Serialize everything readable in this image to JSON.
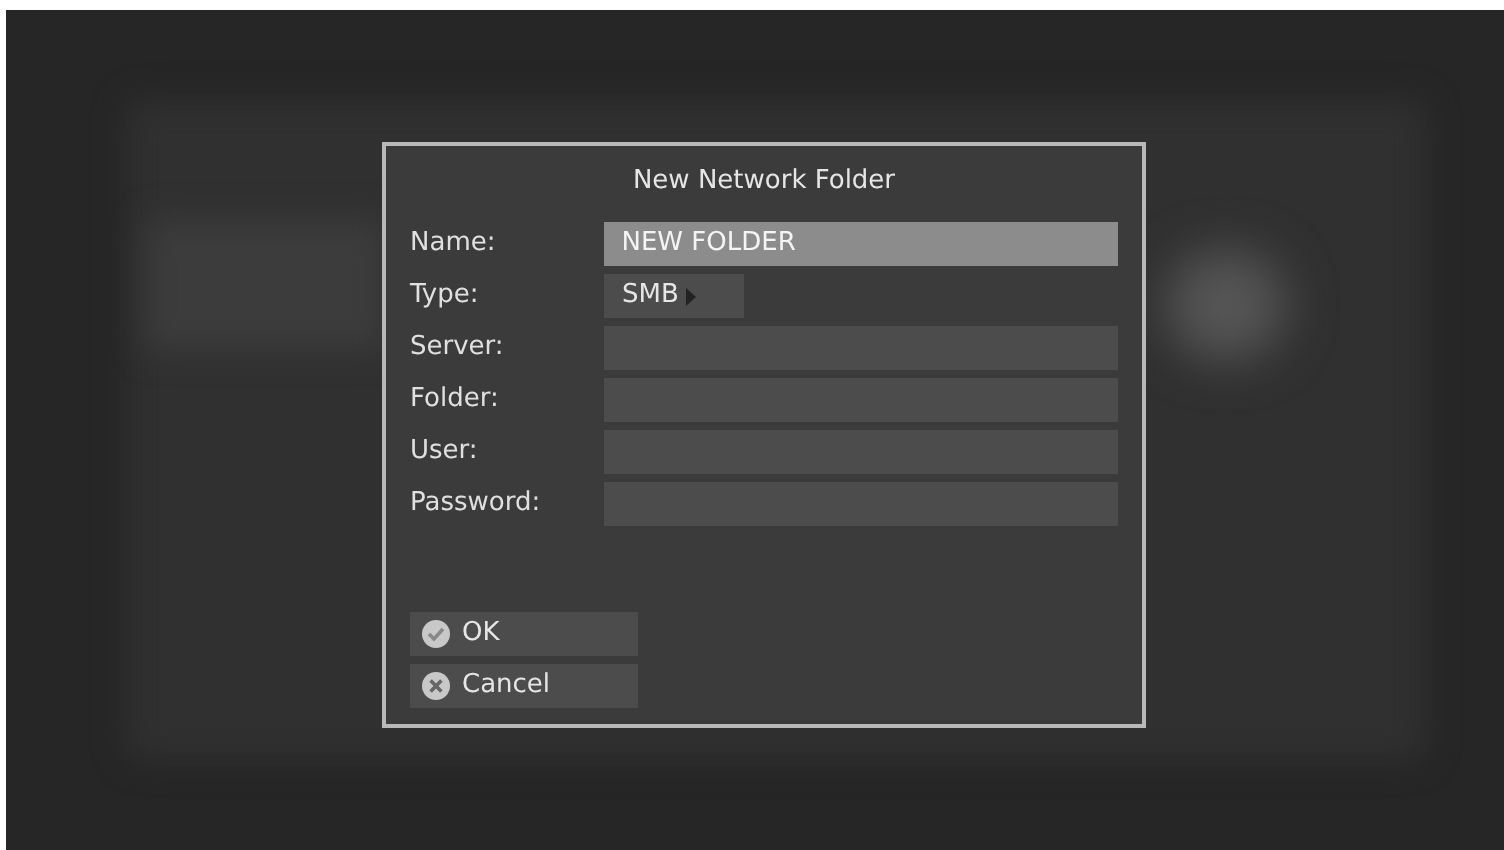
{
  "dialog": {
    "title": "New Network Folder",
    "fields": [
      {
        "label": "Name:",
        "kind": "text",
        "value": "NEW FOLDER",
        "selected": true
      },
      {
        "label": "Type:",
        "kind": "select",
        "value": "SMB",
        "selected": false
      },
      {
        "label": "Server:",
        "kind": "text",
        "selected": false
      },
      {
        "label": "Folder:",
        "kind": "text",
        "selected": false
      },
      {
        "label": "User:",
        "kind": "text",
        "selected": false
      },
      {
        "label": "Password:",
        "kind": "text",
        "selected": false
      }
    ],
    "buttons": [
      {
        "label": "OK",
        "kind": "ok"
      },
      {
        "label": "Cancel",
        "kind": "cancel"
      }
    ]
  }
}
